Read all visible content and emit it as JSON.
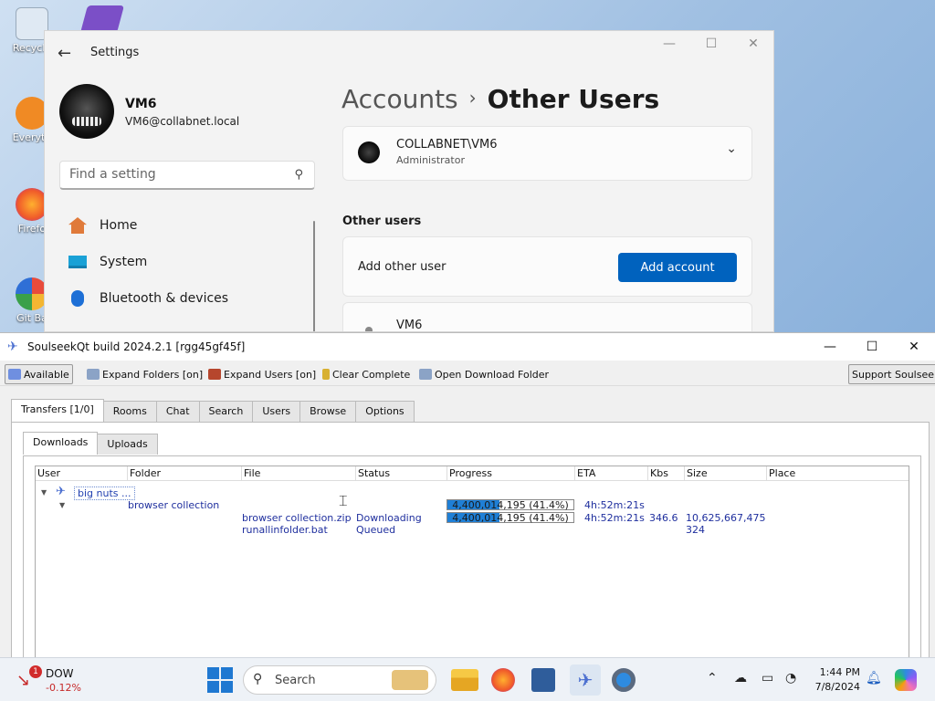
{
  "desktop": {
    "icons": [
      {
        "label": "Recycle",
        "color": "#dfe9f3"
      },
      {
        "label": "Everyth",
        "color": "#f08a24"
      },
      {
        "label": "Firefo",
        "color": "#f05a2a"
      },
      {
        "label": "Git Ba",
        "color": "#e84b3c"
      }
    ]
  },
  "settings": {
    "title": "Settings",
    "controls": {
      "minimize": "—",
      "maximize": "☐",
      "close": "✕"
    },
    "user": {
      "name": "VM6",
      "email": "VM6@collabnet.local"
    },
    "search": {
      "placeholder": "Find a setting"
    },
    "nav": [
      {
        "label": "Home",
        "icon": "home-icon",
        "color": "#e07a3a"
      },
      {
        "label": "System",
        "icon": "monitor-icon",
        "color": "#1aa1d6"
      },
      {
        "label": "Bluetooth & devices",
        "icon": "bluetooth-icon",
        "color": "#1d6fd6"
      }
    ],
    "breadcrumb": {
      "parent": "Accounts",
      "separator": "›",
      "current": "Other Users"
    },
    "current_account": {
      "name": "COLLABNET\\VM6",
      "role": "Administrator"
    },
    "section_heading": "Other users",
    "add_other": {
      "label": "Add other user",
      "button": "Add account"
    },
    "partial_user": {
      "name": "VM6"
    }
  },
  "soulseek": {
    "title": "SoulseekQt build 2024.2.1 [rgg45gf45f]",
    "controls": {
      "minimize": "—",
      "maximize": "☐",
      "close": "✕"
    },
    "toolbar": {
      "status": "Available",
      "expand_folders": "Expand Folders [on]",
      "expand_users": "Expand Users [on]",
      "clear_complete": "Clear Complete",
      "open_download_folder": "Open Download Folder",
      "support": "Support Soulseek!"
    },
    "tabs": [
      "Transfers [1/0]",
      "Rooms",
      "Chat",
      "Search",
      "Users",
      "Browse",
      "Options"
    ],
    "subtabs": [
      "Downloads",
      "Uploads"
    ],
    "columns": [
      "User",
      "Folder",
      "File",
      "Status",
      "Progress",
      "ETA",
      "Kbs",
      "Size",
      "Place"
    ],
    "rows": {
      "user": "big nuts ...",
      "folder": "browser collection",
      "folder_progress": {
        "text": "4,400,014,195 (41.4%)",
        "fraction": 0.414
      },
      "folder_eta": "4h:52m:21s",
      "file1": {
        "name": "browser collection.zip",
        "status": "Downloading",
        "progress_text": "4,400,014,195 (41.4%)",
        "fraction": 0.414,
        "eta": "4h:52m:21s",
        "kbs": "346.6",
        "size": "10,625,667,475"
      },
      "file2": {
        "name": "runallinfolder.bat",
        "status": "Queued",
        "size": "324"
      }
    }
  },
  "taskbar": {
    "ticker": {
      "badge": "1",
      "symbol": "DOW",
      "change": "-0.12%"
    },
    "search": "Search",
    "time": "1:44 PM",
    "date": "7/8/2024"
  }
}
